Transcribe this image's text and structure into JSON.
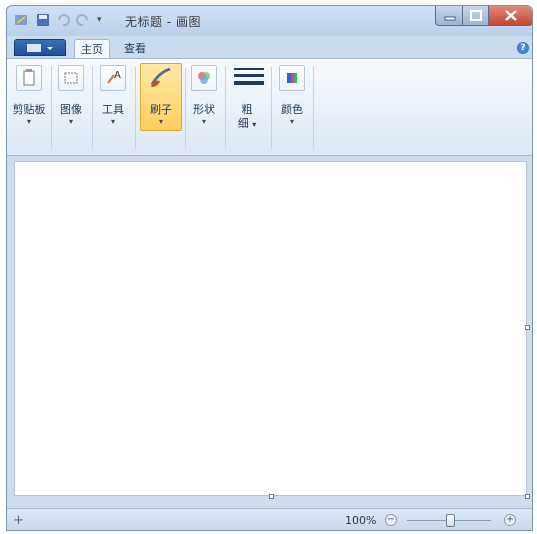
{
  "window": {
    "title": "无标题 - 画图"
  },
  "quick_access": {
    "dropdown_glyph": "▾"
  },
  "ribbon_tabs": {
    "home": "主页",
    "view": "查看"
  },
  "help_glyph": "?",
  "groups": {
    "clipboard": {
      "label": "剪贴板",
      "icon": "clipboard-icon",
      "dropdown": "▾"
    },
    "image": {
      "label": "图像",
      "icon": "image-select-icon",
      "dropdown": "▾"
    },
    "tools": {
      "label": "工具",
      "icon": "tools-icon",
      "dropdown": "▾"
    },
    "brushes": {
      "label": "刷子",
      "icon": "brush-icon",
      "dropdown": "▾",
      "selected": true
    },
    "shapes": {
      "label": "形状",
      "icon": "shapes-icon",
      "dropdown": "▾"
    },
    "size": {
      "label": "粗",
      "label2": "细",
      "icon": "line-size-icon",
      "dropdown": "▾"
    },
    "colors": {
      "label": "颜色",
      "icon": "color-palette-icon",
      "dropdown": "▾"
    }
  },
  "status": {
    "cursor_glyph": "+",
    "zoom": "100%",
    "zoom_out": "−",
    "zoom_in": "+",
    "zoom_level": 0.5
  },
  "colors": {
    "selected_group_fill": "#ffcf5e",
    "close_button": "#c44630",
    "app_menu": "#1f4f98"
  }
}
